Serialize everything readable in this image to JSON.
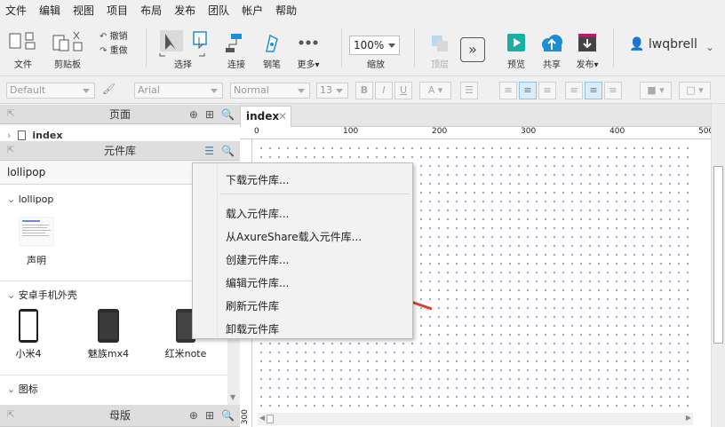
{
  "menubar": {
    "items": [
      "文件",
      "编辑",
      "视图",
      "项目",
      "布局",
      "发布",
      "团队",
      "帐户",
      "帮助"
    ]
  },
  "toolbar": {
    "file": "文件",
    "clipboard": "剪贴板",
    "undo": "撤销",
    "redo": "重做",
    "select": "选择",
    "connect": "连接",
    "pen": "钢笔",
    "more": "更多▾",
    "zoom_value": "100%",
    "zoom": "缩放",
    "top_layer": "顶层",
    "preview": "预览",
    "share": "共享",
    "publish": "发布▾",
    "user": "lwqbrell"
  },
  "formatbar": {
    "style": "Default",
    "font": "Arial",
    "weight": "Normal",
    "size": "13"
  },
  "pages_panel": {
    "title": "页面",
    "tree_item": "index"
  },
  "library_panel": {
    "title": "元件库",
    "selected_library": "lollipop"
  },
  "library_sections": [
    {
      "name": "lollipop",
      "items": [
        "声明"
      ]
    },
    {
      "name": "安卓手机外壳",
      "items": [
        "小米4",
        "魅族mx4",
        "红米note"
      ]
    },
    {
      "name": "图标",
      "items": []
    }
  ],
  "masters_panel": {
    "title": "母版"
  },
  "tab": {
    "label": "index"
  },
  "ruler": {
    "h_ticks": [
      "0",
      "100",
      "200",
      "300",
      "400",
      "500"
    ],
    "v_tick": "300"
  },
  "dropdown": {
    "items": [
      "下载元件库...",
      "载入元件库...",
      "从AxureShare载入元件库...",
      "创建元件库...",
      "编辑元件库...",
      "刷新元件库",
      "卸载元件库"
    ]
  },
  "colors": {
    "accent": "#1a8fd6",
    "arrow": "#e23a2e",
    "preview": "#17b0a2",
    "publish": "#c0166e"
  }
}
